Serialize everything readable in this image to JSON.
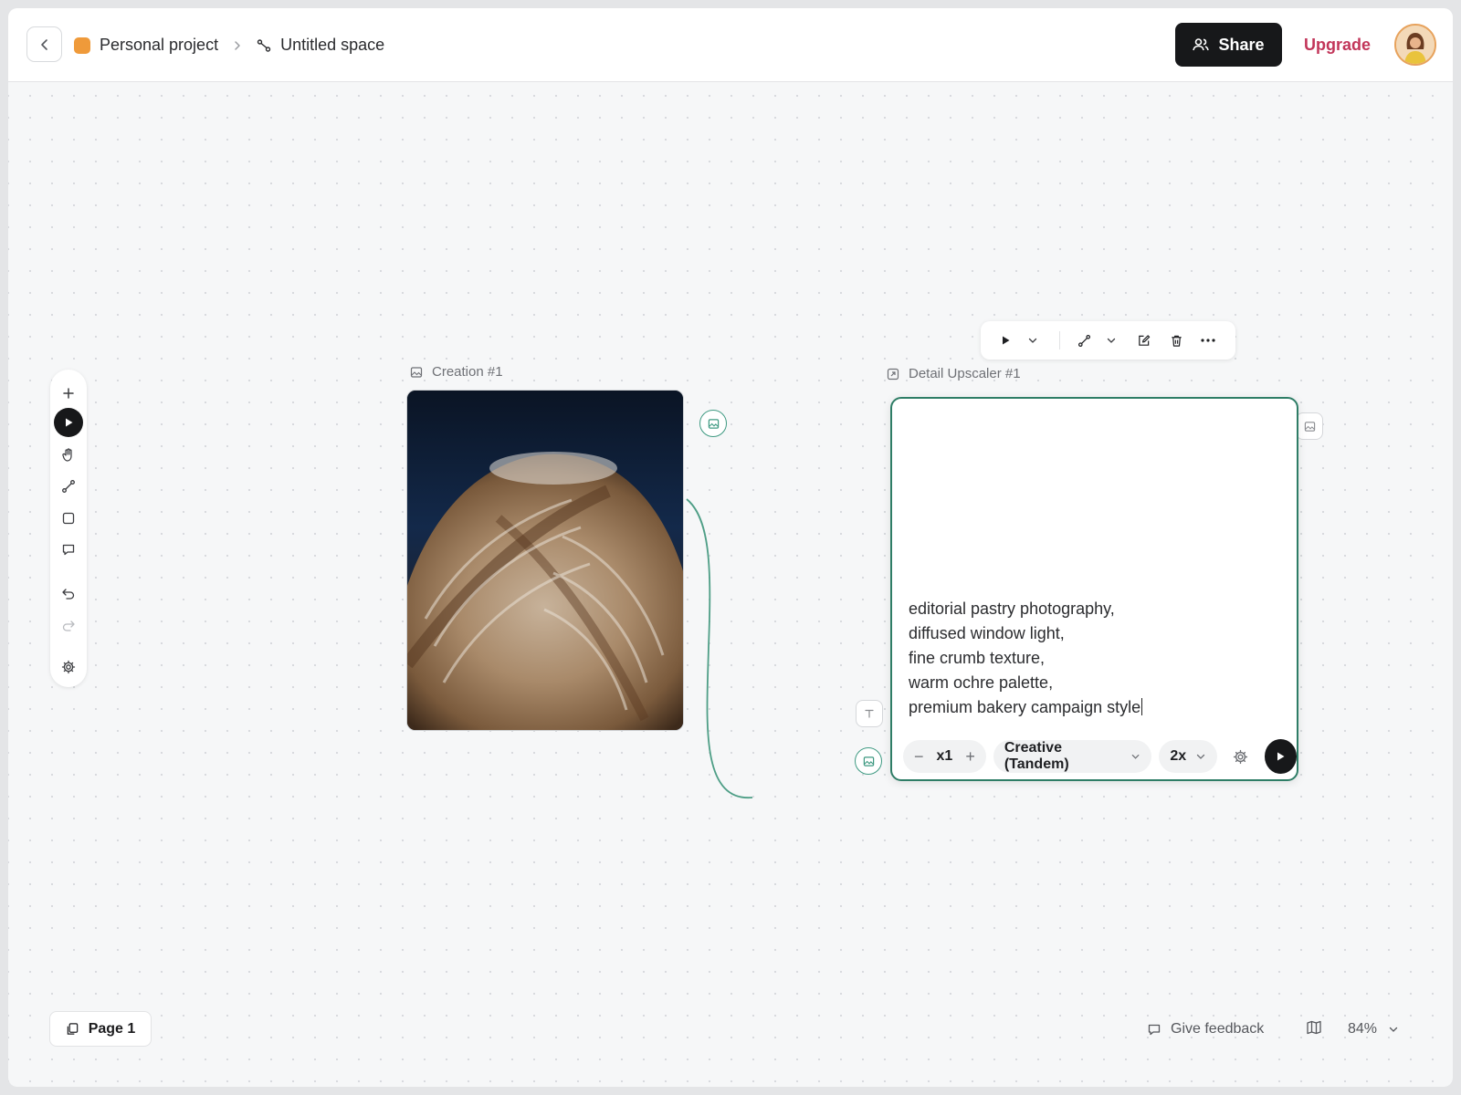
{
  "header": {
    "project_name": "Personal project",
    "space_name": "Untitled space",
    "share_label": "Share",
    "upgrade_label": "Upgrade"
  },
  "toolbar": {
    "tools": [
      "add-icon",
      "play-icon",
      "hand-icon",
      "connector-icon",
      "rectangle-icon",
      "comment-icon",
      "undo-icon",
      "redo-icon",
      "settings-icon"
    ],
    "active_tool": "play-icon"
  },
  "creation_node": {
    "label": "Creation #1"
  },
  "upscaler_node": {
    "label": "Detail Upscaler #1",
    "prompt": "editorial pastry photography,\ndiffused window light,\nfine crumb texture,\nwarm ochre palette,\npremium bakery campaign style",
    "count_value": "x1",
    "count_minus": "−",
    "count_plus": "+",
    "model": "Creative (Tandem)",
    "scale": "2x"
  },
  "node_toolbar": {
    "items": [
      "play-icon",
      "chevron-down-icon",
      "connector-icon",
      "chevron-down-icon",
      "edit-icon",
      "trash-icon",
      "more-icon"
    ]
  },
  "footer": {
    "page_label": "Page 1",
    "feedback_label": "Give feedback",
    "zoom_label": "84%"
  },
  "colors": {
    "accent_green": "#2e7d66",
    "upgrade": "#c2365a",
    "project_swatch": "#ef9a3a",
    "dark": "#17181a"
  }
}
